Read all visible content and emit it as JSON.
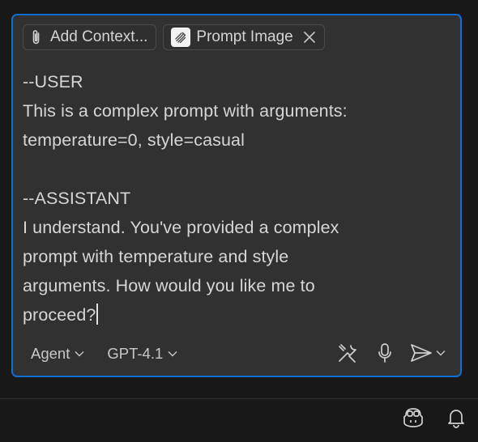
{
  "chips": {
    "add_context": {
      "label": "Add Context...",
      "icon": "paperclip-icon"
    },
    "attachment": {
      "label": "Prompt Image",
      "icon": "prompt-image-icon",
      "close_icon": "close-icon"
    }
  },
  "prompt": {
    "lines": [
      "--USER",
      "This is a complex prompt with arguments:",
      "temperature=0, style=casual",
      "",
      "--ASSISTANT",
      "I understand. You've provided a complex",
      "prompt with temperature and style",
      "arguments. How would you like me to",
      "proceed?"
    ]
  },
  "toolbar": {
    "mode": {
      "label": "Agent",
      "icon": "chevron-down-icon"
    },
    "model": {
      "label": "GPT-4.1",
      "icon": "chevron-down-icon"
    },
    "tools_icon": "tools-icon",
    "mic_icon": "microphone-icon",
    "send_icon": "send-icon",
    "send_menu_icon": "chevron-down-icon"
  },
  "statusbar": {
    "copilot_icon": "copilot-icon",
    "bell_icon": "bell-icon"
  },
  "colors": {
    "background": "#181818",
    "input_background": "#313131",
    "focus_border": "#0e6fd1",
    "text": "#d6d6d6"
  }
}
